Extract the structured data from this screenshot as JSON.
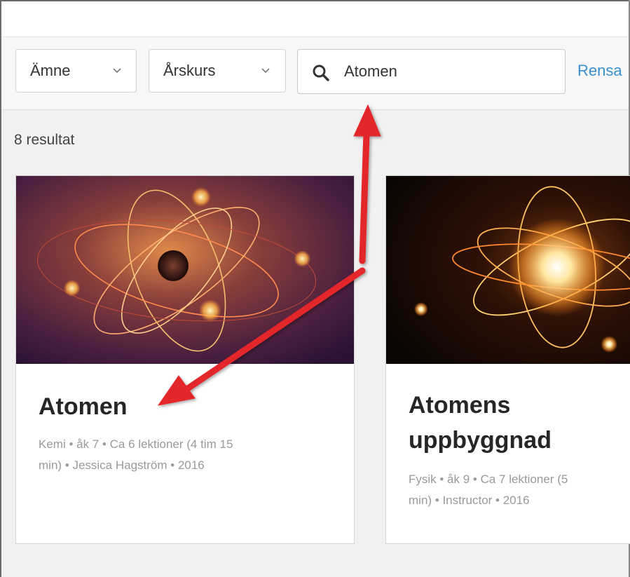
{
  "filters": {
    "subject_label": "Ämne",
    "grade_label": "Årskurs",
    "search_value": "Atomen",
    "clear_label": "Rensa"
  },
  "results": {
    "count_text": "8 resultat",
    "cards": [
      {
        "title": "Atomen",
        "meta_line1": "Kemi • åk 7 • Ca 6 lektioner (4 tim 15",
        "meta_line2": "min) • Jessica Hagström • 2016"
      },
      {
        "title_line1": "Atomens",
        "title_line2": "uppbyggnad",
        "meta_line1": "Fysik • åk 9 • Ca 7 lektioner (5",
        "meta_line2": "min) • Instructor • 2016"
      }
    ]
  },
  "colors": {
    "link": "#3a8fcf",
    "annotation_arrow": "#e3262b"
  },
  "icons": [
    "chevron-down-icon",
    "search-icon",
    "red-annotation-arrow"
  ]
}
